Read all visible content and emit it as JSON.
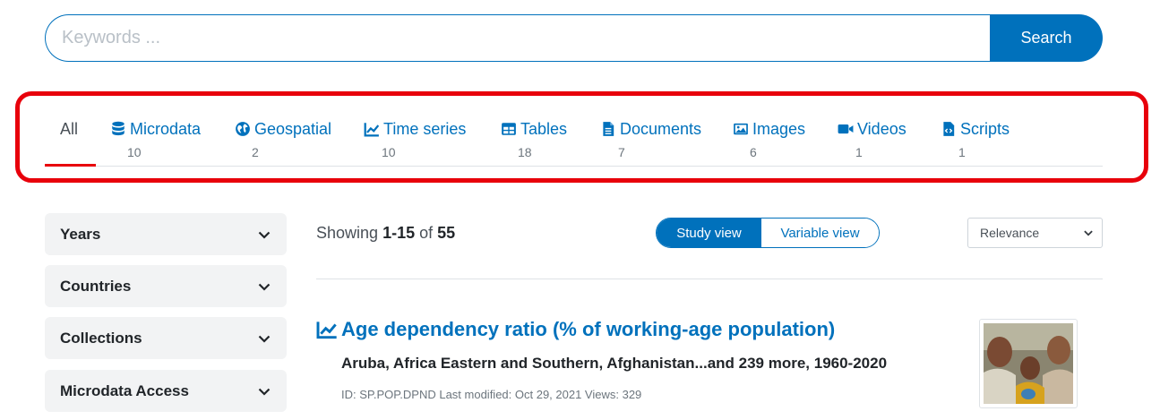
{
  "search": {
    "placeholder": "Keywords ...",
    "button_label": "Search"
  },
  "tabs": [
    {
      "label": "All",
      "count": "",
      "icon": "none",
      "active": true
    },
    {
      "label": "Microdata",
      "count": "10",
      "icon": "database-icon"
    },
    {
      "label": "Geospatial",
      "count": "2",
      "icon": "globe-icon"
    },
    {
      "label": "Time series",
      "count": "10",
      "icon": "line-chart-icon"
    },
    {
      "label": "Tables",
      "count": "18",
      "icon": "table-icon"
    },
    {
      "label": "Documents",
      "count": "7",
      "icon": "document-icon"
    },
    {
      "label": "Images",
      "count": "6",
      "icon": "image-icon"
    },
    {
      "label": "Videos",
      "count": "1",
      "icon": "video-icon"
    },
    {
      "label": "Scripts",
      "count": "1",
      "icon": "script-file-icon"
    }
  ],
  "facets": [
    {
      "label": "Years"
    },
    {
      "label": "Countries"
    },
    {
      "label": "Collections"
    },
    {
      "label": "Microdata Access"
    }
  ],
  "results_header": {
    "showing_prefix": "Showing",
    "range": "1-15",
    "of_word": "of",
    "total": "55",
    "view_study": "Study view",
    "view_variable": "Variable view",
    "sort_selected": "Relevance"
  },
  "result": {
    "title": "Age dependency ratio (% of working-age population)",
    "subtitle": "Aruba, Africa Eastern and Southern, Afghanistan...and 239 more, 1960-2020",
    "meta": "ID: SP.POP.DPND   Last modified: Oct 29, 2021   Views: 329"
  },
  "colors": {
    "brand": "#0071bc",
    "highlight": "#e8000b",
    "facet_bg": "#f2f3f4"
  }
}
